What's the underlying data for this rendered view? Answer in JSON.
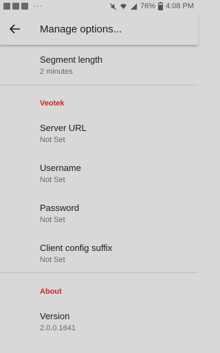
{
  "status_bar": {
    "battery": "76%",
    "time": "4:08 PM",
    "overflow": "···"
  },
  "toolbar": {
    "title": "Manage options..."
  },
  "prefs": {
    "segment_length": {
      "title": "Segment length",
      "summary": "2 minutes"
    },
    "category_veotek": "Veotek",
    "server_url": {
      "title": "Server URL",
      "summary": "Not Set"
    },
    "username": {
      "title": "Username",
      "summary": "Not Set"
    },
    "password": {
      "title": "Password",
      "summary": "Not Set"
    },
    "client_config_suffix": {
      "title": "Client config suffix",
      "summary": "Not Set"
    },
    "category_about": "About",
    "version": {
      "title": "Version",
      "summary": "2.0.0.1641"
    }
  },
  "colors": {
    "background": "#d8d8d8",
    "category_accent": "#c62828"
  }
}
